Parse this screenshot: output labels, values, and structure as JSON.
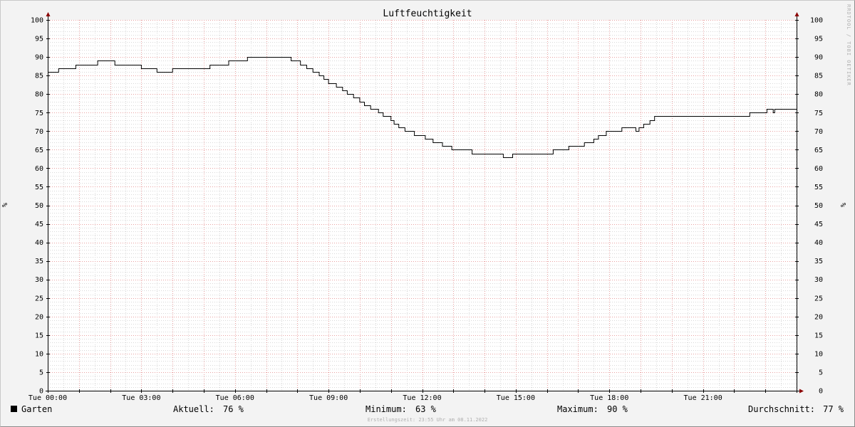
{
  "chart_data": {
    "type": "line",
    "title": "Luftfeuchtigkeit",
    "ylabel_left": "%",
    "ylabel_right": "%",
    "ylim": [
      0,
      100
    ],
    "yticks": [
      0,
      5,
      10,
      15,
      20,
      25,
      30,
      35,
      40,
      45,
      50,
      55,
      60,
      65,
      70,
      75,
      80,
      85,
      90,
      95,
      100
    ],
    "xlim_hours": [
      0,
      24
    ],
    "xticks": [
      {
        "h": 0,
        "label": "Tue 00:00"
      },
      {
        "h": 3,
        "label": "Tue 03:00"
      },
      {
        "h": 6,
        "label": "Tue 06:00"
      },
      {
        "h": 9,
        "label": "Tue 09:00"
      },
      {
        "h": 12,
        "label": "Tue 12:00"
      },
      {
        "h": 15,
        "label": "Tue 15:00"
      },
      {
        "h": 18,
        "label": "Tue 18:00"
      },
      {
        "h": 21,
        "label": "Tue 21:00"
      }
    ],
    "grid": true,
    "series": [
      {
        "name": "Garten",
        "color": "#000000",
        "step": true,
        "points": [
          [
            0.0,
            86
          ],
          [
            0.35,
            87
          ],
          [
            0.9,
            88
          ],
          [
            1.6,
            89
          ],
          [
            2.15,
            88
          ],
          [
            3.0,
            87
          ],
          [
            3.5,
            86
          ],
          [
            4.0,
            87
          ],
          [
            5.2,
            88
          ],
          [
            5.8,
            89
          ],
          [
            6.4,
            90
          ],
          [
            7.8,
            89
          ],
          [
            8.1,
            88
          ],
          [
            8.3,
            87
          ],
          [
            8.5,
            86
          ],
          [
            8.7,
            85
          ],
          [
            8.85,
            84
          ],
          [
            9.0,
            83
          ],
          [
            9.25,
            82
          ],
          [
            9.45,
            81
          ],
          [
            9.6,
            80
          ],
          [
            9.8,
            79
          ],
          [
            10.0,
            78
          ],
          [
            10.15,
            77
          ],
          [
            10.35,
            76
          ],
          [
            10.6,
            75
          ],
          [
            10.75,
            74
          ],
          [
            11.0,
            73
          ],
          [
            11.1,
            72
          ],
          [
            11.25,
            71
          ],
          [
            11.45,
            70
          ],
          [
            11.75,
            69
          ],
          [
            12.1,
            68
          ],
          [
            12.35,
            67
          ],
          [
            12.65,
            66
          ],
          [
            12.95,
            65
          ],
          [
            13.6,
            64
          ],
          [
            14.6,
            63
          ],
          [
            14.9,
            64
          ],
          [
            16.2,
            65
          ],
          [
            16.7,
            66
          ],
          [
            17.2,
            67
          ],
          [
            17.5,
            68
          ],
          [
            17.65,
            69
          ],
          [
            17.9,
            70
          ],
          [
            18.4,
            71
          ],
          [
            18.85,
            70
          ],
          [
            18.95,
            71
          ],
          [
            19.1,
            72
          ],
          [
            19.3,
            73
          ],
          [
            19.45,
            74
          ],
          [
            22.5,
            75
          ],
          [
            23.05,
            76
          ],
          [
            23.25,
            75
          ],
          [
            23.3,
            76
          ],
          [
            24.0,
            76
          ]
        ]
      }
    ]
  },
  "legend": {
    "series_name": "Garten",
    "swatch_color": "#000000",
    "current_label": "Aktuell:",
    "current_value": "76 %",
    "min_label": "Minimum:",
    "min_value": "63 %",
    "max_label": "Maximum:",
    "max_value": "90 %",
    "avg_label": "Durchschnitt:",
    "avg_value": "77 %"
  },
  "footer": {
    "created": "Erstellungszeit: 23:55 Uhr am 08.11.2022"
  },
  "watermark": "RRDTOOL / TOBI OETIKER",
  "colors": {
    "background": "#f3f3f3",
    "plot_background": "#ffffff",
    "major_grid": "#e8a0a0",
    "minor_grid": "#d8d8d8",
    "axis": "#000000",
    "arrow": "#8b0000"
  }
}
